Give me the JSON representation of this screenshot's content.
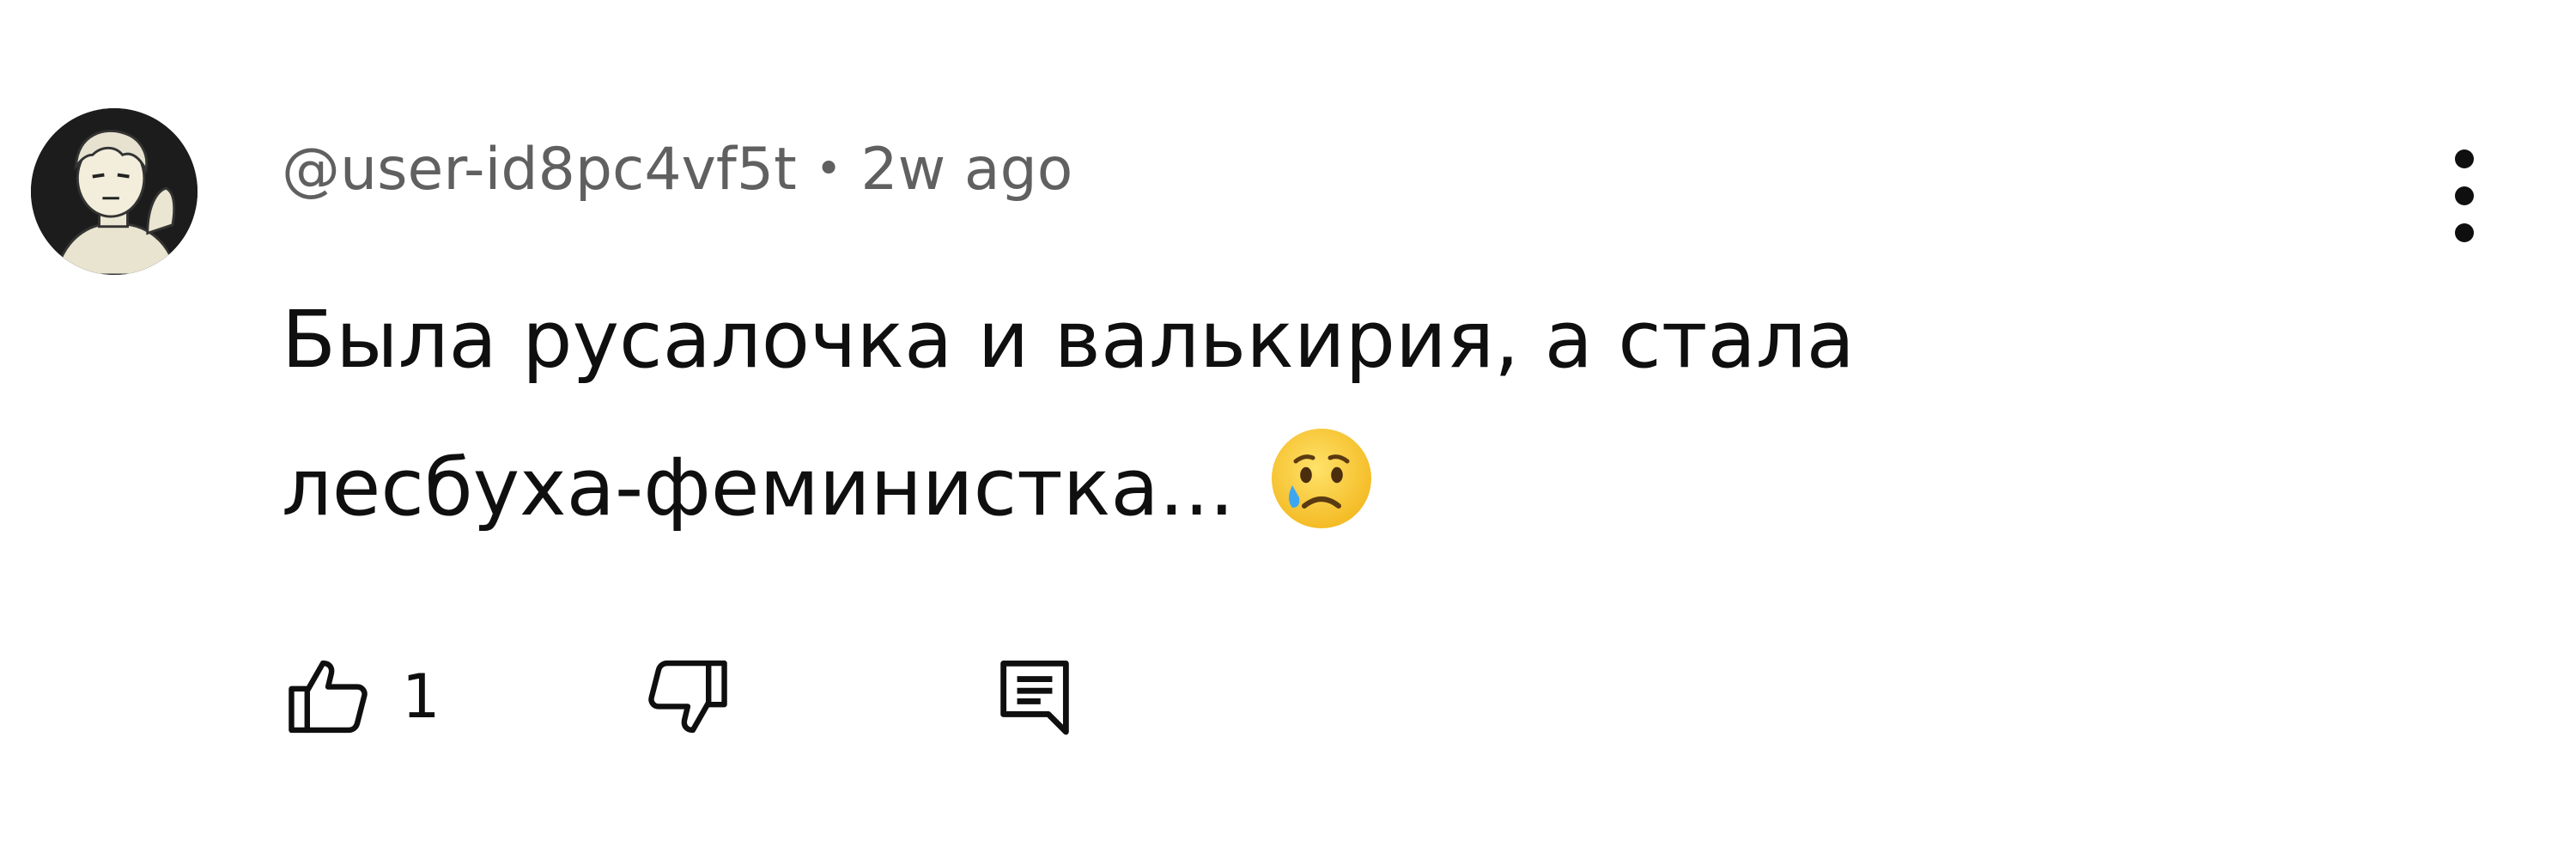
{
  "comment": {
    "author": "@user-id8pc4vf5t",
    "separator": "•",
    "time": "2w ago",
    "text_line1": "Была русалочка и валькирия, а стала",
    "text_line2": "лесбуха-феминистка...",
    "emoji": "crying-face-emoji",
    "like_count": "1"
  },
  "icons": {
    "like": "thumb-up-icon",
    "dislike": "thumb-down-icon",
    "reply": "reply-comment-icon",
    "menu": "more-vertical-icon"
  },
  "colors": {
    "text": "#0f0f0f",
    "meta": "#606060",
    "emoji": "#f7c52b"
  }
}
